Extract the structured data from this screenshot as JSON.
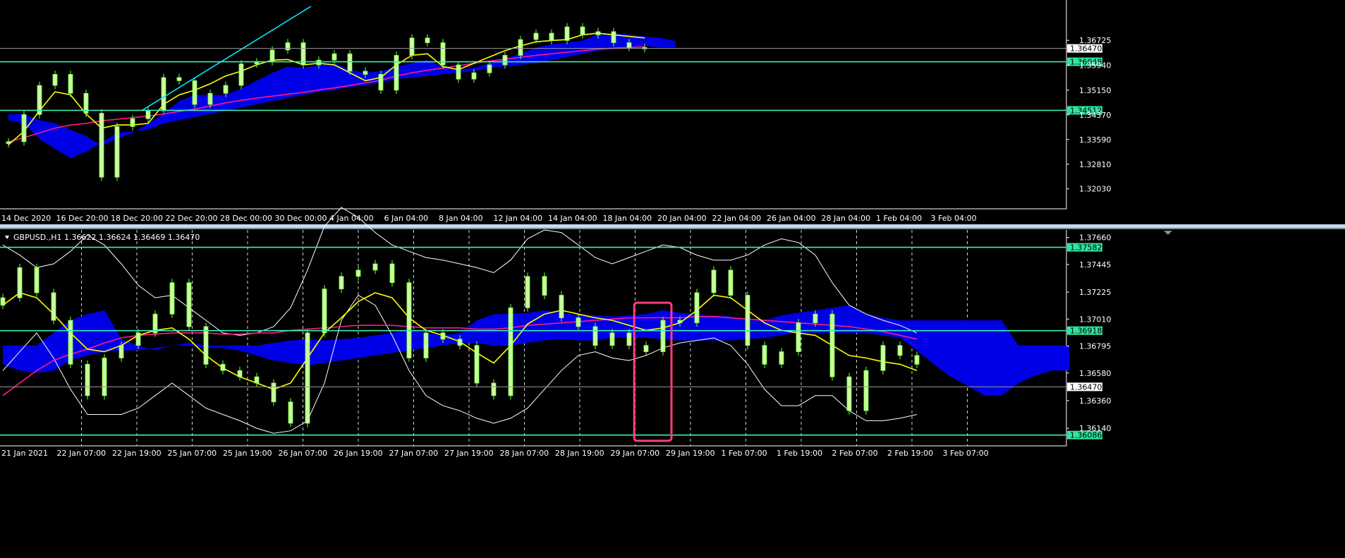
{
  "colors": {
    "background": "#000000",
    "candle": "#c8ff9a",
    "wick": "#7cff4a",
    "cloud": "#0000e6",
    "ma_fast": "#ffff00",
    "ma_slow": "#ff1a8c",
    "trendline": "#00e5ff",
    "level_line": "#3cf0b4",
    "level_label_bg": "#2de6a0",
    "bollinger": "#ffffff",
    "grid": "#ffffff",
    "axis_text": "#ffffff",
    "highlight_box": "#ff3c78",
    "separator": "#c8dcef"
  },
  "icons": {
    "collapse": "triangle-down-icon",
    "scroll": "triangle-down-icon"
  },
  "chart_data": [
    {
      "type": "line",
      "subtype": "candlestick",
      "grid": false,
      "ylim": [
        1.314,
        1.38
      ],
      "x_tick_labels": [
        "14 Dec 2020",
        "16 Dec 20:00",
        "18 Dec 20:00",
        "22 Dec 20:00",
        "28 Dec 00:00",
        "30 Dec 00:00",
        "4 Jan 04:00",
        "6 Jan 04:00",
        "8 Jan 04:00",
        "12 Jan 04:00",
        "14 Jan 04:00",
        "18 Jan 04:00",
        "20 Jan 04:00",
        "22 Jan 04:00",
        "26 Jan 04:00",
        "28 Jan 04:00",
        "1 Feb 04:00",
        "3 Feb 04:00"
      ],
      "y_tick_labels": [
        "1.36725",
        "1.35940",
        "1.35150",
        "1.34370",
        "1.33590",
        "1.32810",
        "1.32030"
      ],
      "y_tick_values": [
        1.36725,
        1.3594,
        1.3515,
        1.3437,
        1.3359,
        1.3281,
        1.3203
      ],
      "current_price": {
        "label": "1.36470",
        "value": 1.3647
      },
      "levels": [
        {
          "label": "1.36048",
          "value": 1.36048
        },
        {
          "label": "1.34512",
          "value": 1.34512
        }
      ],
      "trendline": {
        "from": [
          8.6,
          1.3451
        ],
        "to": [
          19.5,
          1.378
        ]
      },
      "close": [
        1.3352,
        1.3438,
        1.353,
        1.3565,
        1.3505,
        1.3442,
        1.324,
        1.34,
        1.3425,
        1.345,
        1.3555,
        1.3545,
        1.347,
        1.3505,
        1.353,
        1.3598,
        1.3605,
        1.3642,
        1.3665,
        1.3595,
        1.361,
        1.363,
        1.3575,
        1.3565,
        1.3515,
        1.3625,
        1.368,
        1.3665,
        1.3595,
        1.355,
        1.357,
        1.3595,
        1.3625,
        1.3675,
        1.3695,
        1.3672,
        1.3715,
        1.369,
        1.37,
        1.3665,
        1.365,
        1.3647
      ],
      "ma_fast": [
        1.3342,
        1.3385,
        1.345,
        1.351,
        1.35,
        1.344,
        1.3395,
        1.3405,
        1.3405,
        1.341,
        1.347,
        1.35,
        1.3515,
        1.3535,
        1.356,
        1.3575,
        1.3595,
        1.361,
        1.3612,
        1.3595,
        1.36,
        1.3595,
        1.357,
        1.3545,
        1.3555,
        1.3595,
        1.3625,
        1.363,
        1.359,
        1.358,
        1.36,
        1.362,
        1.364,
        1.3655,
        1.3668,
        1.3672,
        1.3675,
        1.369,
        1.3695,
        1.369,
        1.3685,
        1.368
      ],
      "ma_slow": [
        1.3352,
        1.3365,
        1.338,
        1.3395,
        1.3405,
        1.341,
        1.3418,
        1.3423,
        1.3428,
        1.3433,
        1.344,
        1.3448,
        1.3455,
        1.3465,
        1.3475,
        1.3483,
        1.349,
        1.3496,
        1.3502,
        1.3508,
        1.3516,
        1.3522,
        1.353,
        1.3538,
        1.3546,
        1.356,
        1.357,
        1.3578,
        1.3585,
        1.3592,
        1.36,
        1.3607,
        1.3613,
        1.3619,
        1.3625,
        1.363,
        1.3635,
        1.364,
        1.3645,
        1.3648,
        1.365,
        1.3652
      ],
      "cloud_upper": [
        1.344,
        1.344,
        1.342,
        1.341,
        1.339,
        1.337,
        1.334,
        1.336,
        1.338,
        1.341,
        1.344,
        1.348,
        1.35,
        1.35,
        1.35,
        1.352,
        1.3545,
        1.357,
        1.359,
        1.3585,
        1.3595,
        1.36,
        1.358,
        1.357,
        1.3575,
        1.359,
        1.36,
        1.361,
        1.359,
        1.358,
        1.3585,
        1.36,
        1.3615,
        1.363,
        1.365,
        1.366,
        1.3665,
        1.3672,
        1.369,
        1.3695,
        1.369,
        1.3685,
        1.368,
        1.367
      ],
      "cloud_lower": [
        1.342,
        1.341,
        1.336,
        1.333,
        1.33,
        1.332,
        1.335,
        1.338,
        1.3385,
        1.339,
        1.341,
        1.342,
        1.343,
        1.344,
        1.345,
        1.346,
        1.347,
        1.348,
        1.349,
        1.35,
        1.351,
        1.3515,
        1.3525,
        1.353,
        1.354,
        1.355,
        1.3555,
        1.356,
        1.3565,
        1.357,
        1.3575,
        1.3585,
        1.359,
        1.3595,
        1.36,
        1.361,
        1.362,
        1.363,
        1.364,
        1.3645,
        1.365,
        1.3655,
        1.365,
        1.365
      ]
    },
    {
      "type": "line",
      "subtype": "candlestick",
      "grid": true,
      "title": "GBPUSD.,H1  1.36622 1.36624 1.36469 1.36470",
      "ylim": [
        1.36,
        1.3772
      ],
      "x_tick_labels": [
        "21 Jan 2021",
        "22 Jan 07:00",
        "22 Jan 19:00",
        "25 Jan 07:00",
        "25 Jan 19:00",
        "26 Jan 07:00",
        "26 Jan 19:00",
        "27 Jan 07:00",
        "27 Jan 19:00",
        "28 Jan 07:00",
        "28 Jan 19:00",
        "29 Jan 07:00",
        "29 Jan 19:00",
        "1 Feb 07:00",
        "1 Feb 19:00",
        "2 Feb 07:00",
        "2 Feb 19:00",
        "3 Feb 07:00"
      ],
      "y_tick_labels": [
        "1.37660",
        "1.37445",
        "1.37225",
        "1.37010",
        "1.36795",
        "1.36580",
        "1.36360",
        "1.36140"
      ],
      "y_tick_values": [
        1.3766,
        1.37445,
        1.37225,
        1.3701,
        1.36795,
        1.3658,
        1.3636,
        1.3614
      ],
      "current_price": {
        "label": "1.36470",
        "value": 1.3647
      },
      "levels": [
        {
          "label": "1.37582",
          "value": 1.37582
        },
        {
          "label": "1.36918",
          "value": 1.36918
        },
        {
          "label": "1.36086",
          "value": 1.36086
        }
      ],
      "highlight": {
        "x_range": [
          37.3,
          39.5
        ],
        "y_range": [
          1.3604,
          1.3714
        ]
      },
      "close": [
        1.3718,
        1.3742,
        1.3722,
        1.37,
        1.3665,
        1.364,
        1.367,
        1.368,
        1.369,
        1.3705,
        1.373,
        1.3695,
        1.3665,
        1.366,
        1.3655,
        1.365,
        1.3635,
        1.3618,
        1.369,
        1.3725,
        1.3735,
        1.374,
        1.3745,
        1.373,
        1.367,
        1.369,
        1.3685,
        1.368,
        1.365,
        1.364,
        1.371,
        1.3735,
        1.372,
        1.3702,
        1.3695,
        1.368,
        1.369,
        1.368,
        1.3675,
        1.37,
        1.3698,
        1.3722,
        1.374,
        1.372,
        1.368,
        1.3665,
        1.3675,
        1.3698,
        1.3705,
        1.3655,
        1.3628,
        1.366,
        1.368,
        1.3672,
        1.3665
      ],
      "ma_fast": [
        1.3712,
        1.3722,
        1.3718,
        1.3705,
        1.369,
        1.3677,
        1.3675,
        1.368,
        1.3688,
        1.3692,
        1.3694,
        1.3685,
        1.3672,
        1.3662,
        1.3655,
        1.365,
        1.3645,
        1.365,
        1.367,
        1.369,
        1.3702,
        1.3715,
        1.3722,
        1.3718,
        1.3702,
        1.3692,
        1.3688,
        1.3683,
        1.3674,
        1.3666,
        1.368,
        1.3697,
        1.3705,
        1.3708,
        1.3705,
        1.3702,
        1.37,
        1.3696,
        1.3692,
        1.3694,
        1.3698,
        1.3708,
        1.372,
        1.3718,
        1.3708,
        1.3698,
        1.3692,
        1.369,
        1.3688,
        1.368,
        1.3672,
        1.367,
        1.3667,
        1.3665,
        1.366
      ],
      "ma_slow": [
        1.364,
        1.365,
        1.366,
        1.3668,
        1.3673,
        1.3677,
        1.3682,
        1.3686,
        1.3688,
        1.3689,
        1.369,
        1.369,
        1.369,
        1.3689,
        1.3689,
        1.369,
        1.369,
        1.3692,
        1.3693,
        1.3694,
        1.3695,
        1.3696,
        1.3696,
        1.3696,
        1.3695,
        1.3694,
        1.3694,
        1.3694,
        1.3693,
        1.3693,
        1.3694,
        1.3696,
        1.3697,
        1.3698,
        1.3699,
        1.37,
        1.3701,
        1.3702,
        1.3702,
        1.3702,
        1.3702,
        1.3703,
        1.3703,
        1.3702,
        1.3701,
        1.37,
        1.3699,
        1.3698,
        1.3697,
        1.3696,
        1.3695,
        1.3693,
        1.3691,
        1.3688,
        1.3685
      ],
      "bb_upper": [
        1.376,
        1.3752,
        1.3742,
        1.3745,
        1.3755,
        1.3768,
        1.376,
        1.3745,
        1.3728,
        1.3718,
        1.372,
        1.371,
        1.37,
        1.369,
        1.3688,
        1.369,
        1.3695,
        1.371,
        1.374,
        1.3775,
        1.379,
        1.3782,
        1.377,
        1.376,
        1.3755,
        1.375,
        1.3748,
        1.3745,
        1.3742,
        1.3738,
        1.3748,
        1.3765,
        1.3772,
        1.377,
        1.376,
        1.375,
        1.3745,
        1.375,
        1.3755,
        1.376,
        1.3758,
        1.3752,
        1.3748,
        1.3748,
        1.3752,
        1.376,
        1.3765,
        1.3762,
        1.3752,
        1.373,
        1.3712,
        1.3705,
        1.37,
        1.3696,
        1.369
      ],
      "bb_lower": [
        1.366,
        1.3675,
        1.369,
        1.367,
        1.3645,
        1.3625,
        1.3625,
        1.3625,
        1.363,
        1.364,
        1.365,
        1.364,
        1.363,
        1.3625,
        1.362,
        1.3614,
        1.361,
        1.3612,
        1.362,
        1.365,
        1.37,
        1.372,
        1.3712,
        1.3688,
        1.366,
        1.364,
        1.3632,
        1.3628,
        1.3622,
        1.3618,
        1.3622,
        1.363,
        1.3645,
        1.366,
        1.3672,
        1.3675,
        1.367,
        1.3668,
        1.3672,
        1.3678,
        1.3682,
        1.3684,
        1.3686,
        1.368,
        1.3665,
        1.3645,
        1.3632,
        1.3632,
        1.364,
        1.364,
        1.3628,
        1.362,
        1.362,
        1.3622,
        1.3625
      ],
      "cloud_upper": [
        1.368,
        1.368,
        1.368,
        1.369,
        1.37,
        1.3705,
        1.3708,
        1.3685,
        1.368,
        1.3676,
        1.368,
        1.3682,
        1.368,
        1.368,
        1.368,
        1.368,
        1.3682,
        1.3684,
        1.3685,
        1.3684,
        1.3685,
        1.3686,
        1.3688,
        1.369,
        1.3692,
        1.369,
        1.3688,
        1.369,
        1.37,
        1.3705,
        1.3705,
        1.3706,
        1.3708,
        1.3706,
        1.3704,
        1.3704,
        1.3703,
        1.3704,
        1.3705,
        1.3708,
        1.3706,
        1.3705,
        1.3704,
        1.3703,
        1.37,
        1.37,
        1.3704,
        1.3706,
        1.3708,
        1.371,
        1.3712,
        1.3705,
        1.3702,
        1.37,
        1.37,
        1.37,
        1.37,
        1.37,
        1.37,
        1.37,
        1.368,
        1.368,
        1.368,
        1.368
      ],
      "cloud_lower": [
        1.3665,
        1.366,
        1.3658,
        1.366,
        1.3668,
        1.3672,
        1.3675,
        1.3676,
        1.3676,
        1.3678,
        1.368,
        1.368,
        1.3678,
        1.3678,
        1.3676,
        1.3672,
        1.3668,
        1.3666,
        1.3664,
        1.3666,
        1.3668,
        1.367,
        1.3672,
        1.3674,
        1.3676,
        1.3678,
        1.368,
        1.3682,
        1.3682,
        1.368,
        1.368,
        1.3682,
        1.3684,
        1.3685,
        1.3684,
        1.3684,
        1.3686,
        1.3686,
        1.3686,
        1.3685,
        1.3684,
        1.3684,
        1.3684,
        1.3684,
        1.3685,
        1.3686,
        1.3688,
        1.369,
        1.369,
        1.369,
        1.369,
        1.369,
        1.3688,
        1.3686,
        1.3676,
        1.3665,
        1.3655,
        1.3648,
        1.364,
        1.364,
        1.365,
        1.3656,
        1.366,
        1.366
      ]
    }
  ]
}
